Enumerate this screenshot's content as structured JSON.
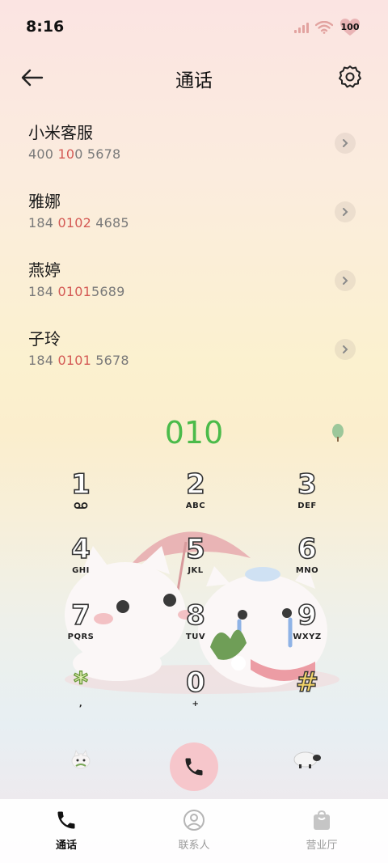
{
  "status": {
    "time": "8:16",
    "battery": "100"
  },
  "header": {
    "title": "通话"
  },
  "contacts": [
    {
      "name": "小米客服",
      "num_a": "400 ",
      "num_hl": "10",
      "num_b": "0 5678"
    },
    {
      "name": "雅娜",
      "num_a": "184 ",
      "num_hl": "0102",
      "num_b": " 4685"
    },
    {
      "name": "燕婷",
      "num_a": "184 ",
      "num_hl": "0101",
      "num_b": "5689"
    },
    {
      "name": "子玲",
      "num_a": "184 ",
      "num_hl": "0101",
      "num_b": " 5678"
    }
  ],
  "dialer": {
    "number": "010",
    "keys": [
      {
        "digit": "1",
        "letters": ""
      },
      {
        "digit": "2",
        "letters": "ABC"
      },
      {
        "digit": "3",
        "letters": "DEF"
      },
      {
        "digit": "4",
        "letters": "GHI"
      },
      {
        "digit": "5",
        "letters": "JKL"
      },
      {
        "digit": "6",
        "letters": "MNO"
      },
      {
        "digit": "7",
        "letters": "PQRS"
      },
      {
        "digit": "8",
        "letters": "TUV"
      },
      {
        "digit": "9",
        "letters": "WXYZ"
      },
      {
        "digit": "*",
        "letters": ","
      },
      {
        "digit": "0",
        "letters": "+"
      },
      {
        "digit": "#",
        "letters": ""
      }
    ]
  },
  "tabs": [
    {
      "label": "通话",
      "icon": "phone-icon",
      "active": true
    },
    {
      "label": "联系人",
      "icon": "person-icon",
      "active": false
    },
    {
      "label": "营业厅",
      "icon": "bag-icon",
      "active": false
    }
  ],
  "colors": {
    "accent_green": "#4bbb4a",
    "highlight_red": "#d45a55",
    "call_button": "#f6c6cb"
  }
}
